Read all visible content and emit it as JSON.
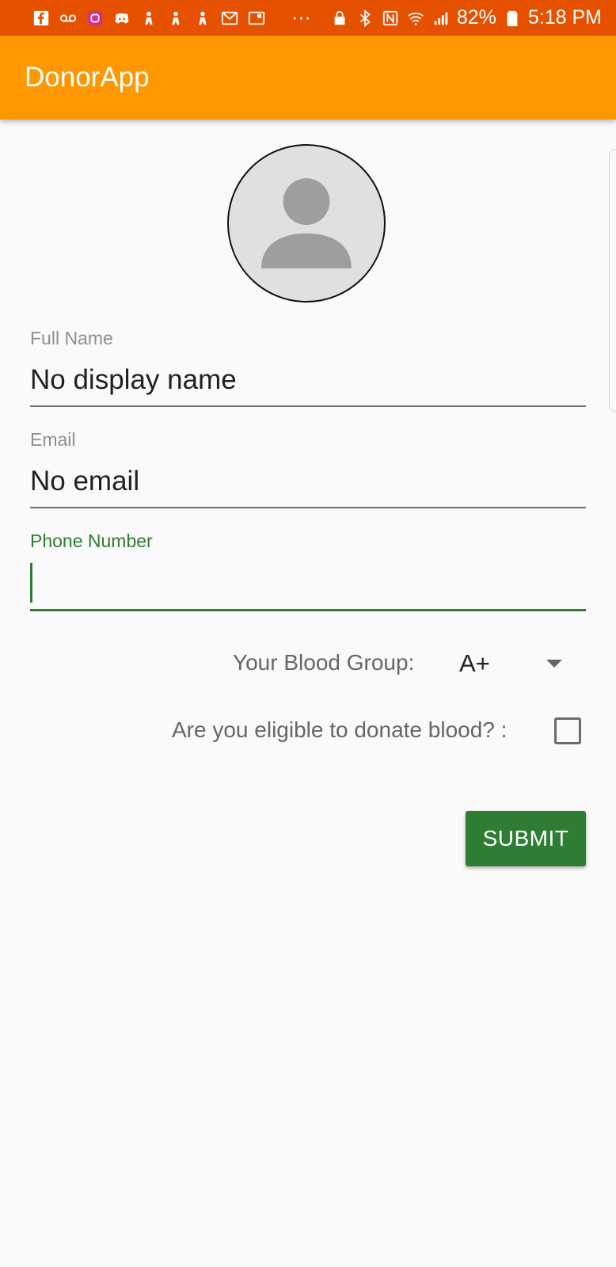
{
  "status_bar": {
    "left_icons": [
      "facebook-icon",
      "voicemail-icon",
      "instagram-icon",
      "discord-icon",
      "person-icon",
      "person-icon",
      "person-icon",
      "gmail-icon",
      "maps-icon"
    ],
    "more": "···",
    "right_icons": [
      "lock-icon",
      "bluetooth-icon",
      "nfc-icon",
      "wifi-icon",
      "signal-icon"
    ],
    "battery": "82%",
    "battery_icon": "battery-icon",
    "time": "5:18 PM"
  },
  "app_bar": {
    "title": "DonorApp",
    "color": "#ff9800"
  },
  "avatar": {
    "icon": "person-placeholder-icon"
  },
  "form": {
    "full_name": {
      "label": "Full Name",
      "value": "No display name"
    },
    "email": {
      "label": "Email",
      "value": "No email"
    },
    "phone": {
      "label": "Phone Number",
      "value": ""
    },
    "blood_group": {
      "label": "Your Blood Group:",
      "value": "A+"
    },
    "eligible": {
      "label": "Are you eligible to donate blood? :",
      "checked": false
    },
    "submit_label": "SUBMIT"
  },
  "colors": {
    "status_bar": "#e65100",
    "accent": "#2e7d32",
    "primary": "#ff9800"
  }
}
